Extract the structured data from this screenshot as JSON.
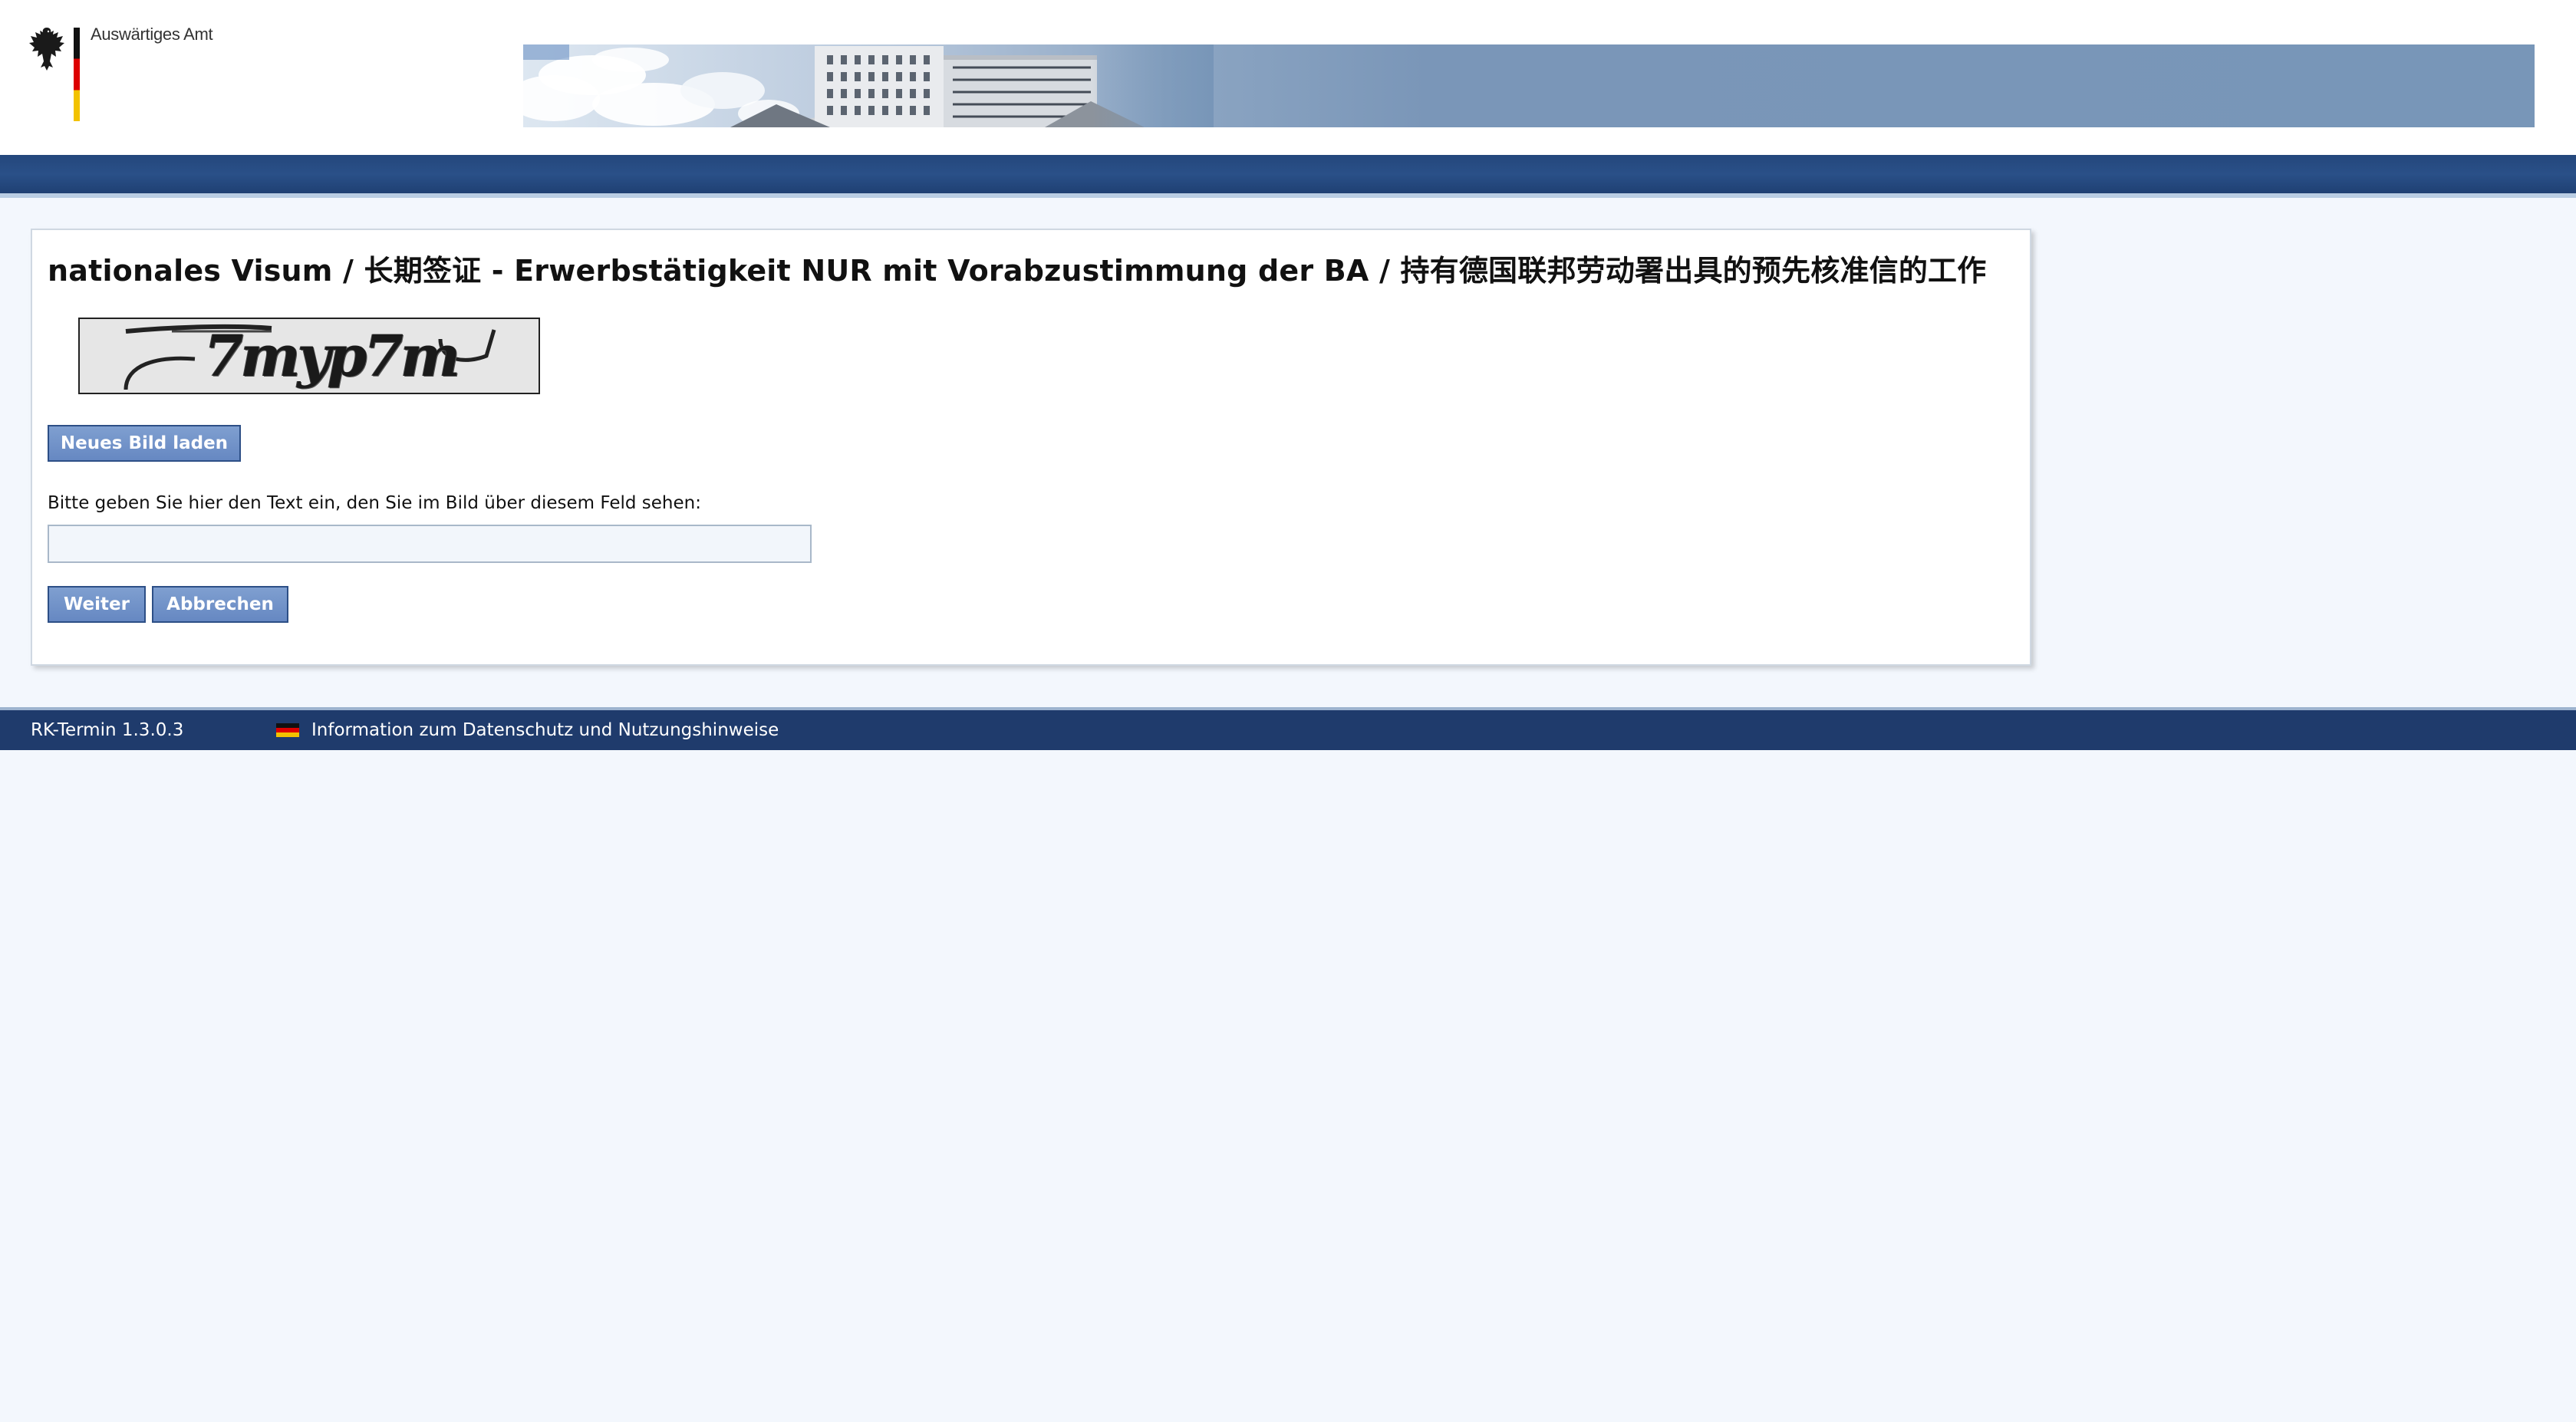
{
  "header": {
    "logo_text": "Auswärtiges Amt",
    "banner_image": "building-banner"
  },
  "page": {
    "title": "nationales Visum / 长期签证 - Erwerbstätigkeit NUR mit Vorabzustimmung der BA / 持有德国联邦劳动署出具的预先核准信的工作"
  },
  "captcha": {
    "image_text": "7myp7m",
    "reload_label": "Neues Bild laden",
    "field_label": "Bitte geben Sie hier den Text ein, den Sie im Bild über diesem Feld sehen:",
    "input_value": ""
  },
  "actions": {
    "next_label": "Weiter",
    "cancel_label": "Abbrechen"
  },
  "footer": {
    "version": "RK-Termin 1.3.0.3",
    "privacy_link": "Information zum Datenschutz und Nutzungshinweise"
  },
  "colors": {
    "nav_bar": "#24477c",
    "footer": "#1f3b6c",
    "button": "#6688c2",
    "page_background": "#f3f7fd"
  }
}
